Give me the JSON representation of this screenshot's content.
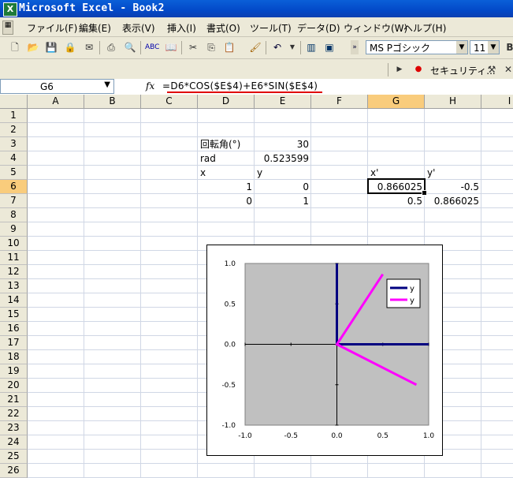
{
  "window": {
    "title": "Microsoft Excel - Book2",
    "app_icon": "excel-icon"
  },
  "menu": [
    {
      "label": "ファイル(F)"
    },
    {
      "label": "編集(E)"
    },
    {
      "label": "表示(V)"
    },
    {
      "label": "挿入(I)"
    },
    {
      "label": "書式(O)"
    },
    {
      "label": "ツール(T)"
    },
    {
      "label": "データ(D)"
    },
    {
      "label": "ウィンドウ(W)"
    },
    {
      "label": "ヘルプ(H)"
    }
  ],
  "toolbar": {
    "font_name": "MS Pゴシック",
    "font_size": "11",
    "security_label": "セキュリティ..."
  },
  "formula_bar": {
    "name_box": "G6",
    "fx": "fx",
    "formula": "=D6*COS($E$4)+E6*SIN($E$4)"
  },
  "columns": [
    "A",
    "B",
    "C",
    "D",
    "E",
    "F",
    "G",
    "H",
    "I"
  ],
  "rows": [
    "1",
    "2",
    "3",
    "4",
    "5",
    "6",
    "7",
    "8",
    "9",
    "10",
    "11",
    "12",
    "13",
    "14",
    "15",
    "16",
    "17",
    "18",
    "19",
    "20",
    "21",
    "22",
    "23",
    "24",
    "25",
    "26"
  ],
  "cells": {
    "D3": "回転角(°)",
    "E3": "30",
    "D4": "rad",
    "E4": "0.523599",
    "D5": "x",
    "E5": "y",
    "G5": "x'",
    "H5": "y'",
    "D6": "1",
    "E6": "0",
    "G6": "0.866025",
    "H6": "-0.5",
    "D7": "0",
    "E7": "1",
    "G7": "0.5",
    "H7": "0.866025"
  },
  "chart_data": {
    "type": "scatter",
    "xlim": [
      -1.0,
      1.0
    ],
    "ylim": [
      -1.0,
      1.0
    ],
    "x_ticks": [
      "-1.0",
      "-0.5",
      "0.0",
      "0.5",
      "1.0"
    ],
    "y_ticks": [
      "1.0",
      "0.5",
      "0.0",
      "-0.5",
      "-1.0"
    ],
    "plot_bg": "#c0c0c0",
    "legend_position": "top-right",
    "series": [
      {
        "name": "y",
        "color": "#000080",
        "points": [
          [
            0,
            1
          ],
          [
            0,
            0
          ],
          [
            1,
            0
          ]
        ]
      },
      {
        "name": "y",
        "color": "#ff00ff",
        "points": [
          [
            0.5,
            0.866025
          ],
          [
            0,
            0
          ],
          [
            0.866025,
            -0.5
          ]
        ]
      }
    ]
  }
}
